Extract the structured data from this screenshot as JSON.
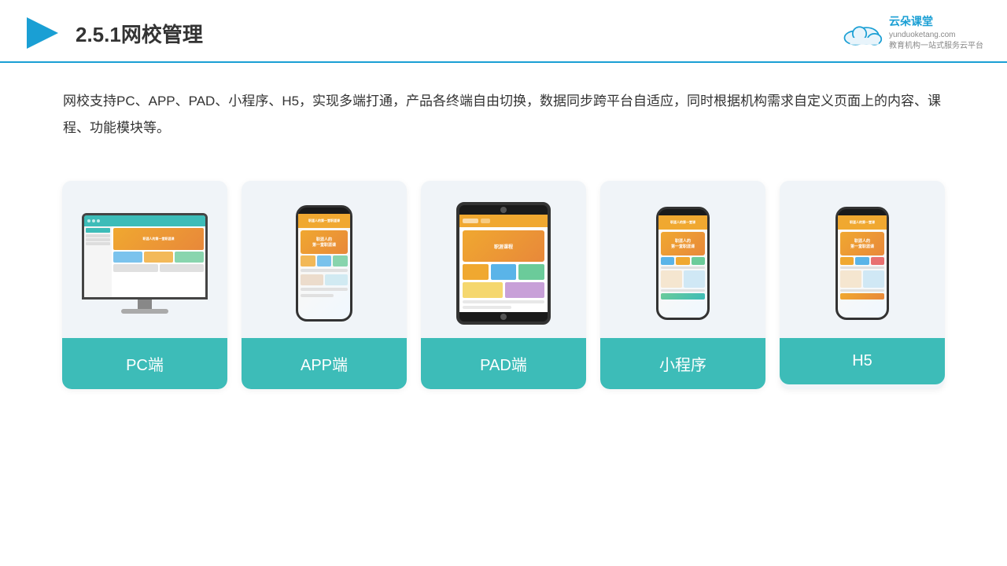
{
  "header": {
    "section_num": "2.5.1",
    "title": "网校管理",
    "logo_name": "云朵课堂",
    "logo_domain": "yunduoketang.com",
    "logo_tagline": "教育机构一站式服务云平台"
  },
  "description": {
    "text": "网校支持PC、APP、PAD、小程序、H5，实现多端打通，产品各终端自由切换，数据同步跨平台自适应，同时根据机构需求自定义页面上的内容、课程、功能模块等。"
  },
  "cards": [
    {
      "id": "pc",
      "label": "PC端"
    },
    {
      "id": "app",
      "label": "APP端"
    },
    {
      "id": "pad",
      "label": "PAD端"
    },
    {
      "id": "miniprogram",
      "label": "小程序"
    },
    {
      "id": "h5",
      "label": "H5"
    }
  ],
  "colors": {
    "accent": "#3dbcb8",
    "header_line": "#1a9fd4",
    "title": "#333333",
    "text": "#333333",
    "card_bg": "#f0f4f8"
  }
}
